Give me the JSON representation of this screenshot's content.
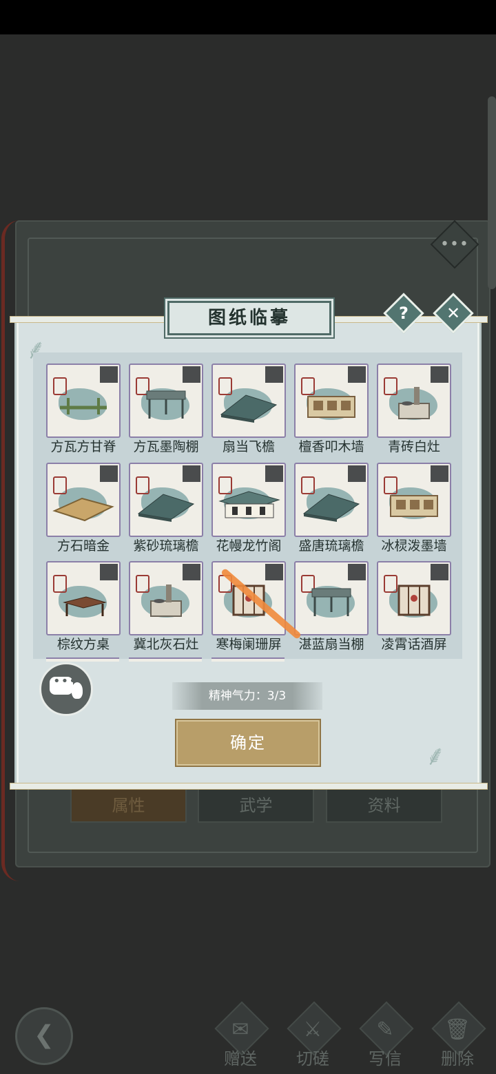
{
  "background": {
    "tabs": [
      "属性",
      "武学",
      "资料"
    ],
    "more_glyph": "•••"
  },
  "dialog": {
    "title": "图纸临摹",
    "help_glyph": "?",
    "close_glyph": "✕",
    "items": [
      {
        "name": "方瓦方甘脊",
        "icon": "beam-icon"
      },
      {
        "name": "方瓦墨陶棚",
        "icon": "canopy-icon"
      },
      {
        "name": "扇当飞檐",
        "icon": "roof-icon"
      },
      {
        "name": "檀香叩木墙",
        "icon": "wall-icon"
      },
      {
        "name": "青砖白灶",
        "icon": "stove-icon"
      },
      {
        "name": "方石暗金",
        "icon": "floor-icon"
      },
      {
        "name": "紫砂琉璃檐",
        "icon": "roof-icon"
      },
      {
        "name": "花幔龙竹阁",
        "icon": "pavilion-icon"
      },
      {
        "name": "盛唐琉璃檐",
        "icon": "roof-icon"
      },
      {
        "name": "冰棂泼墨墙",
        "icon": "wall-icon"
      },
      {
        "name": "棕纹方桌",
        "icon": "table-icon"
      },
      {
        "name": "冀北灰石灶",
        "icon": "stove-icon"
      },
      {
        "name": "寒梅阑珊屏",
        "icon": "screen-icon"
      },
      {
        "name": "湛蓝扇当棚",
        "icon": "canopy-icon"
      },
      {
        "name": "凌霄话酒屏",
        "icon": "screen-icon"
      }
    ],
    "spirit_label": "精神气力：3/3",
    "confirm_label": "确定"
  },
  "bottom_bar": {
    "back_glyph": "❮",
    "buttons": [
      {
        "label": "赠送",
        "icon": "scroll-icon",
        "glyph": "✉"
      },
      {
        "label": "切磋",
        "icon": "sword-icon",
        "glyph": "⚔"
      },
      {
        "label": "写信",
        "icon": "letter-icon",
        "glyph": "✎"
      },
      {
        "label": "删除",
        "icon": "trash-icon",
        "glyph": "🗑"
      }
    ]
  },
  "colors": {
    "dialog_bg": "#d7e1e2",
    "card_border": "#8b7fa8",
    "confirm_bg": "#b89e69",
    "annotation_stroke": "#f08a3c"
  }
}
